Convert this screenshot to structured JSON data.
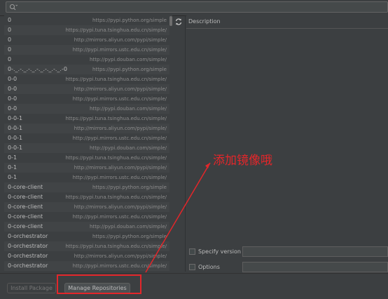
{
  "search": {
    "icon": "search-icon",
    "value": ""
  },
  "packages": [
    {
      "name": "0",
      "url": "https://pypi.python.org/simple"
    },
    {
      "name": "0",
      "url": "https://pypi.tuna.tsinghua.edu.cn/simple/"
    },
    {
      "name": "0",
      "url": "http://mirrors.aliyun.com/pypi/simple/"
    },
    {
      "name": "0",
      "url": "http://pypi.mirrors.ustc.edu.cn/simple/"
    },
    {
      "name": "0",
      "url": "http://pypi.douban.com/simple/"
    },
    {
      "name": "0-._.-._.-._.-._.-._.-._.-0",
      "url": "https://pypi.python.org/simple"
    },
    {
      "name": "0-0",
      "url": "https://pypi.tuna.tsinghua.edu.cn/simple/"
    },
    {
      "name": "0-0",
      "url": "http://mirrors.aliyun.com/pypi/simple/"
    },
    {
      "name": "0-0",
      "url": "http://pypi.mirrors.ustc.edu.cn/simple/"
    },
    {
      "name": "0-0",
      "url": "http://pypi.douban.com/simple/"
    },
    {
      "name": "0-0-1",
      "url": "https://pypi.tuna.tsinghua.edu.cn/simple/"
    },
    {
      "name": "0-0-1",
      "url": "http://mirrors.aliyun.com/pypi/simple/"
    },
    {
      "name": "0-0-1",
      "url": "http://pypi.mirrors.ustc.edu.cn/simple/"
    },
    {
      "name": "0-0-1",
      "url": "http://pypi.douban.com/simple/"
    },
    {
      "name": "0-1",
      "url": "https://pypi.tuna.tsinghua.edu.cn/simple/"
    },
    {
      "name": "0-1",
      "url": "http://mirrors.aliyun.com/pypi/simple/"
    },
    {
      "name": "0-1",
      "url": "http://pypi.mirrors.ustc.edu.cn/simple/"
    },
    {
      "name": "0-core-client",
      "url": "https://pypi.python.org/simple"
    },
    {
      "name": "0-core-client",
      "url": "https://pypi.tuna.tsinghua.edu.cn/simple/"
    },
    {
      "name": "0-core-client",
      "url": "http://mirrors.aliyun.com/pypi/simple/"
    },
    {
      "name": "0-core-client",
      "url": "http://pypi.mirrors.ustc.edu.cn/simple/"
    },
    {
      "name": "0-core-client",
      "url": "http://pypi.douban.com/simple/"
    },
    {
      "name": "0-orchestrator",
      "url": "https://pypi.python.org/simple"
    },
    {
      "name": "0-orchestrator",
      "url": "https://pypi.tuna.tsinghua.edu.cn/simple/"
    },
    {
      "name": "0-orchestrator",
      "url": "http://mirrors.aliyun.com/pypi/simple/"
    },
    {
      "name": "0-orchestrator",
      "url": "http://pypi.mirrors.ustc.edu.cn/simple/"
    }
  ],
  "description": {
    "header": "Description"
  },
  "options": {
    "specify_version_label": "Specify version",
    "options_label": "Options"
  },
  "buttons": {
    "install_package": "Install Package",
    "manage_repositories": "Manage Repositories"
  },
  "annotation": {
    "text": "添加镜像哦",
    "color": "#e3262a"
  },
  "icons": {
    "refresh": "refresh-icon"
  }
}
